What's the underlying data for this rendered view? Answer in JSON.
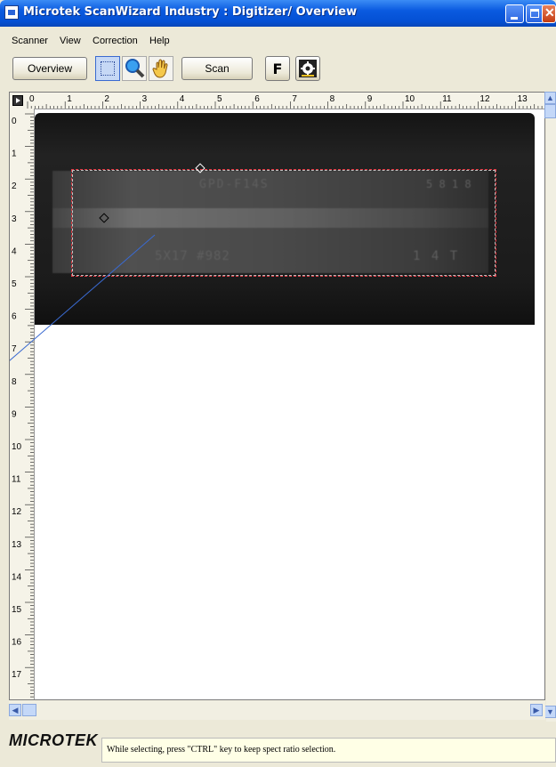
{
  "window": {
    "title": "Microtek ScanWizard Industry : Digitizer/ Overview"
  },
  "menu": {
    "items": [
      "Scanner",
      "View",
      "Correction",
      "Help"
    ]
  },
  "toolbar": {
    "overview_label": "Overview",
    "scan_label": "Scan",
    "f_label": "F"
  },
  "ruler": {
    "top_labels": [
      "0",
      "1",
      "2",
      "3",
      "4",
      "5",
      "6",
      "7",
      "8",
      "9",
      "10",
      "11",
      "12",
      "13"
    ],
    "left_labels": [
      "0",
      "1",
      "2",
      "3",
      "4",
      "5",
      "6",
      "7",
      "8",
      "9",
      "10",
      "11",
      "12",
      "13",
      "14",
      "15",
      "16",
      "17"
    ]
  },
  "preview": {
    "film_text": [
      "GPD-F14S",
      "5 8 1 8",
      "5X17 #982",
      "1 4 T"
    ]
  },
  "status": {
    "logo": "MICROTEK",
    "message": "While selecting, press \"CTRL\" key to keep spect ratio selection."
  },
  "colors": {
    "title_bar": "#0a5ae0",
    "selection_border": "#d6303a",
    "film_dark": "#1c1c1c",
    "status_bg": "#ffffe6"
  }
}
